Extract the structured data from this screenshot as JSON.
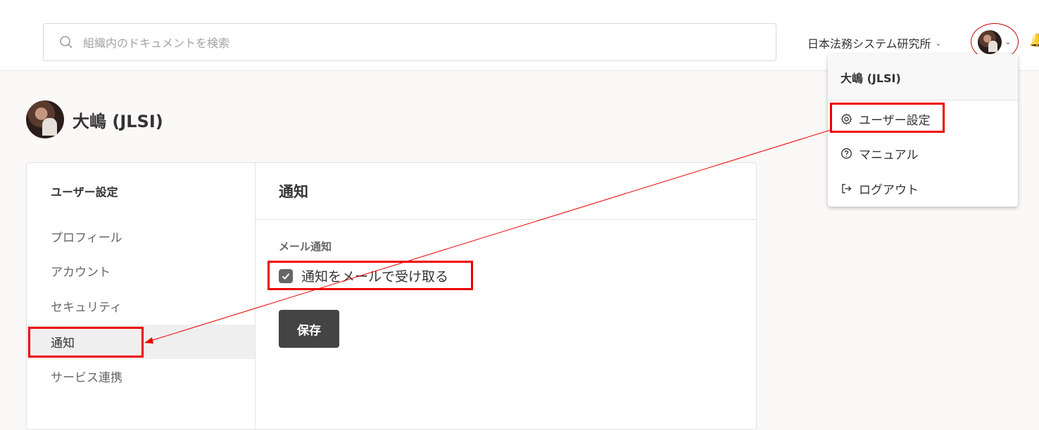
{
  "header": {
    "search_placeholder": "組織内のドキュメントを検索",
    "organization": "日本法務システム研究所"
  },
  "profile": {
    "name": "大嶋 (JLSI)"
  },
  "sidebar": {
    "title": "ユーザー設定",
    "items": [
      {
        "label": "プロフィール"
      },
      {
        "label": "アカウント"
      },
      {
        "label": "セキュリティ"
      },
      {
        "label": "通知"
      },
      {
        "label": "サービス連携"
      }
    ]
  },
  "main": {
    "title": "通知",
    "section_label": "メール通知",
    "checkbox_label": "通知をメールで受け取る",
    "checkbox_checked": true,
    "save_label": "保存"
  },
  "dropdown": {
    "user": "大嶋 (JLSI)",
    "items": [
      {
        "label": "ユーザー設定",
        "icon": "gear-icon"
      },
      {
        "label": "マニュアル",
        "icon": "help-circle-icon"
      },
      {
        "label": "ログアウト",
        "icon": "logout-icon"
      }
    ]
  },
  "annotation_color": "#e00000"
}
